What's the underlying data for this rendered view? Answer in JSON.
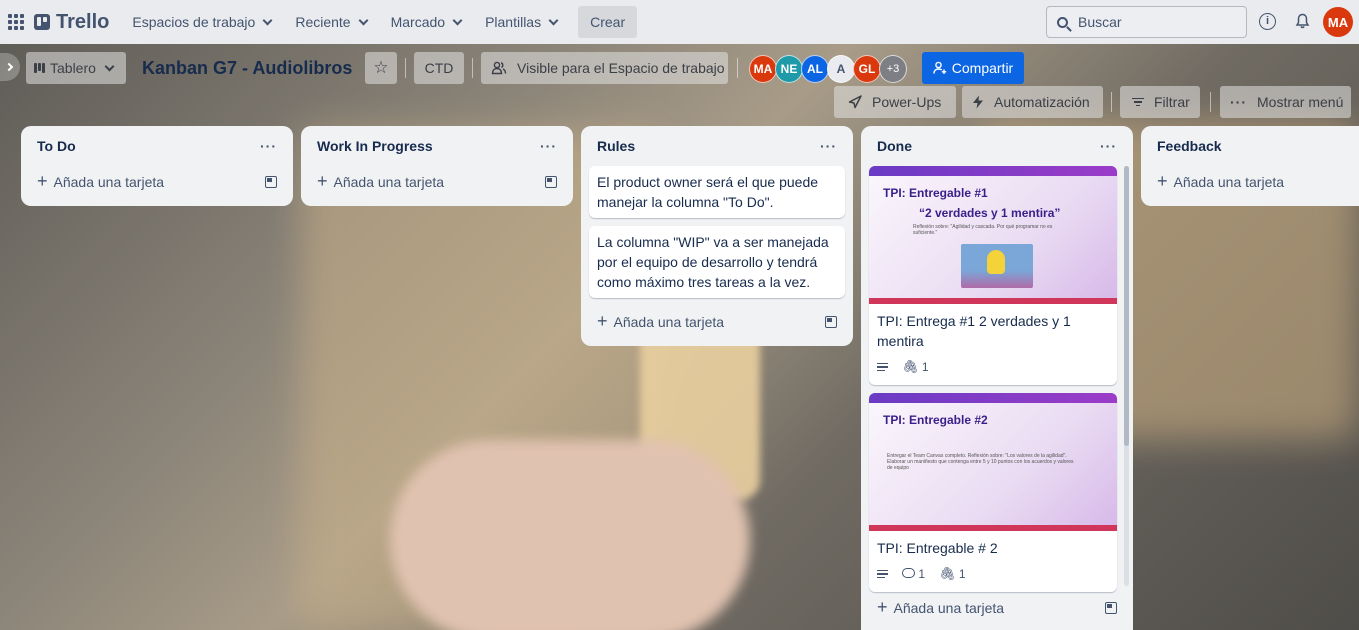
{
  "topnav": {
    "brand": "Trello",
    "menus": [
      "Espacios de trabajo",
      "Reciente",
      "Marcado",
      "Plantillas"
    ],
    "create_label": "Crear",
    "search_placeholder": "Buscar",
    "info_label": "i",
    "user_initials": "MA"
  },
  "board": {
    "view_label": "Tablero",
    "title": "Kanban G7 - Audiolibros",
    "ctd_label": "CTD",
    "visibility_label": "Visible para el Espacio de trabajo",
    "members": [
      {
        "initials": "MA",
        "color": "#d9390d"
      },
      {
        "initials": "NE",
        "color": "#1f9aa8"
      },
      {
        "initials": "AL",
        "color": "#0c66e4"
      },
      {
        "initials": "A",
        "color": "#e9ebee"
      },
      {
        "initials": "GL",
        "color": "#d9390d"
      }
    ],
    "members_more": "+3",
    "share_label": "Compartir",
    "powerups_label": "Power-Ups",
    "automation_label": "Automatización",
    "filter_label": "Filtrar",
    "menu_label": "Mostrar menú"
  },
  "add_card_label": "Añada una tarjeta",
  "lists": [
    {
      "title": "To Do"
    },
    {
      "title": "Work In Progress"
    },
    {
      "title": "Rules",
      "cards": [
        "El product owner será el que puede manejar la columna \"To Do\".",
        "La columna \"WIP\" va a ser manejada por el equipo de desarrollo y tendrá como máximo tres tareas a la vez."
      ]
    },
    {
      "title": "Done",
      "cards": [
        {
          "title": "TPI: Entrega #1 2 verdades y 1 mentira",
          "attachments": "1",
          "cover": {
            "heading": "TPI: Entregable #1",
            "subheading": "“2 verdades y 1 mentira”",
            "body": "Reflexión sobre: \"Agilidad y cascada. Por qué programar no es suficiente.\""
          }
        },
        {
          "title": "TPI: Entregable # 2",
          "comments": "1",
          "attachments": "1",
          "cover": {
            "heading": "TPI: Entregable #2",
            "body": "Entregar el Team Canvas completo. Reflexión sobre: \"Los valores de la agilidad\". Elaborar un manifiesto que contenga entre 5 y 10 puntos con los acuerdos y valores de equipo"
          }
        }
      ]
    },
    {
      "title": "Feedback"
    }
  ]
}
